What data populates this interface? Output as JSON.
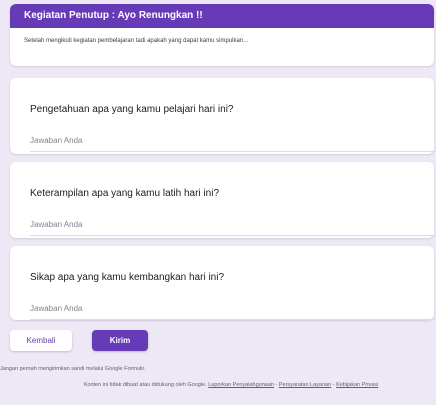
{
  "section": {
    "title": "Kegiatan Penutup : Ayo Renungkan !!",
    "description": "Setelah mengikuti kegiatan pembelajaran tadi apakah yang dapat kamu simpulkan..."
  },
  "questions": [
    {
      "title": "Pengetahuan apa yang kamu pelajari hari ini?",
      "placeholder": "Jawaban Anda"
    },
    {
      "title": "Keterampilan apa yang kamu latih hari ini?",
      "placeholder": "Jawaban Anda"
    },
    {
      "title": "Sikap apa yang kamu kembangkan hari ini?",
      "placeholder": "Jawaban Anda"
    }
  ],
  "buttons": {
    "back": "Kembali",
    "submit": "Kirim"
  },
  "warning": "Jangan pernah mengirimkan sandi melalui Google Formulir.",
  "footer": {
    "text": "Konten ini tidak dibuat atau didukung oleh Google.",
    "links": [
      "Laporkan Penyalahgunaan",
      "Persyaratan Layanan",
      "Kebijakan Privasi"
    ],
    "separator": "-"
  },
  "colors": {
    "accent": "#673ab7",
    "background": "#ede7f6"
  }
}
